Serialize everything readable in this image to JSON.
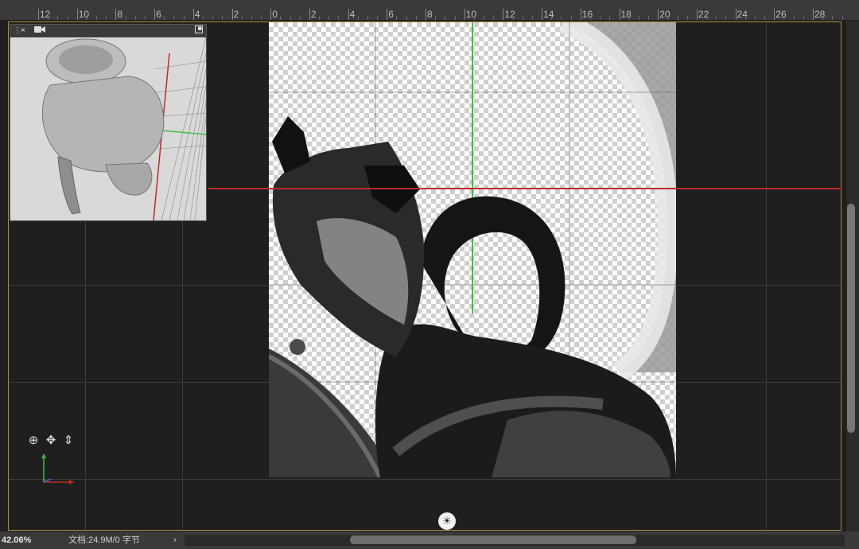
{
  "ruler": {
    "labels": [
      "12",
      "10",
      "8",
      "6",
      "4",
      "2",
      "0",
      "2",
      "4",
      "6",
      "8",
      "10",
      "12",
      "14",
      "16",
      "18",
      "20",
      "22",
      "24",
      "26",
      "28"
    ]
  },
  "mini_viewer": {
    "icons": [
      "panel-grip-icon",
      "close-icon",
      "camera-icon",
      "expand-icon"
    ],
    "close_glyph": "×"
  },
  "tools_3d": {
    "items": [
      {
        "name": "orbit-3d-icon",
        "glyph": "⊕"
      },
      {
        "name": "pan-3d-icon",
        "glyph": "✥"
      },
      {
        "name": "dolly-3d-icon",
        "glyph": "⇕"
      }
    ]
  },
  "colors": {
    "guide_red": "#c02a2a",
    "guide_green": "#3fbf4a",
    "frame_accent": "#b08a3a",
    "workspace_bg": "#1f1f1f"
  },
  "status_bar": {
    "zoom": "42.06%",
    "doc_info": "文档:24.9M/0 字节",
    "arrow": "›"
  },
  "light_widget": {
    "icon": "sun-light-icon",
    "glyph": "☀"
  }
}
